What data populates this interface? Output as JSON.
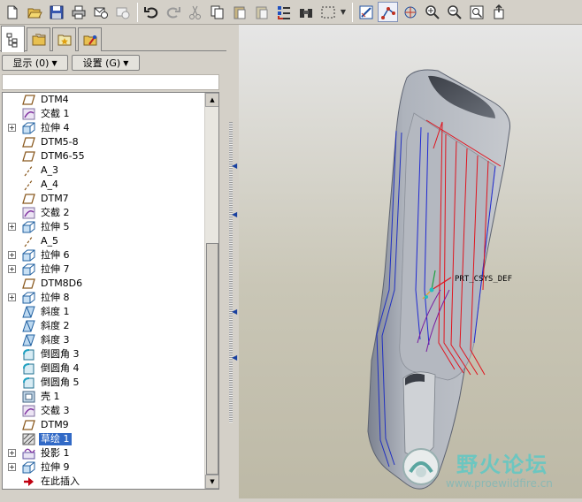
{
  "display_label": "显示 (0)",
  "settings_label": "设置 (G)",
  "tree_items": [
    {
      "label": "DTM4",
      "icon": "datum-plane-icon",
      "expander": false
    },
    {
      "label": "交截 1",
      "icon": "intersect-icon",
      "expander": false
    },
    {
      "label": "拉伸 4",
      "icon": "extrude-icon",
      "expander": true
    },
    {
      "label": "DTM5-8",
      "icon": "datum-plane-icon",
      "expander": false
    },
    {
      "label": "DTM6-55",
      "icon": "datum-plane-icon",
      "expander": false
    },
    {
      "label": "A_3",
      "icon": "datum-axis-icon",
      "expander": false
    },
    {
      "label": "A_4",
      "icon": "datum-axis-icon",
      "expander": false
    },
    {
      "label": "DTM7",
      "icon": "datum-plane-icon",
      "expander": false
    },
    {
      "label": "交截 2",
      "icon": "intersect-icon",
      "expander": false
    },
    {
      "label": "拉伸 5",
      "icon": "extrude-icon",
      "expander": true
    },
    {
      "label": "A_5",
      "icon": "datum-axis-icon",
      "expander": false
    },
    {
      "label": "拉伸 6",
      "icon": "extrude-icon",
      "expander": true
    },
    {
      "label": "拉伸 7",
      "icon": "extrude-icon",
      "expander": true
    },
    {
      "label": "DTM8D6",
      "icon": "datum-plane-icon",
      "expander": false
    },
    {
      "label": "拉伸 8",
      "icon": "extrude-icon",
      "expander": true
    },
    {
      "label": "斜度 1",
      "icon": "draft-icon",
      "expander": false
    },
    {
      "label": "斜度 2",
      "icon": "draft-icon",
      "expander": false
    },
    {
      "label": "斜度 3",
      "icon": "draft-icon",
      "expander": false
    },
    {
      "label": "倒圆角 3",
      "icon": "round-icon",
      "expander": false
    },
    {
      "label": "倒圆角 4",
      "icon": "round-icon",
      "expander": false
    },
    {
      "label": "倒圆角 5",
      "icon": "round-icon",
      "expander": false
    },
    {
      "label": "壳 1",
      "icon": "shell-icon",
      "expander": false
    },
    {
      "label": "交截 3",
      "icon": "intersect-icon",
      "expander": false
    },
    {
      "label": "DTM9",
      "icon": "datum-plane-icon",
      "expander": false
    },
    {
      "label": "草绘 1",
      "icon": "sketch-icon",
      "expander": false,
      "selected": true
    },
    {
      "label": "投影 1",
      "icon": "project-icon",
      "expander": true
    },
    {
      "label": "拉伸 9",
      "icon": "extrude-icon",
      "expander": true
    },
    {
      "label": "在此插入",
      "icon": "insert-here-icon",
      "expander": false
    }
  ],
  "viewport": {
    "csys_label": "PRT_CSYS_DEF",
    "watermark_text": "野火论坛",
    "watermark_url": "www.proewildfire.cn"
  },
  "colors": {
    "selection": "#3169c6",
    "curve_red": "#e0141e",
    "curve_blue": "#1e28d2",
    "model_grey": "#9aa0aa"
  }
}
